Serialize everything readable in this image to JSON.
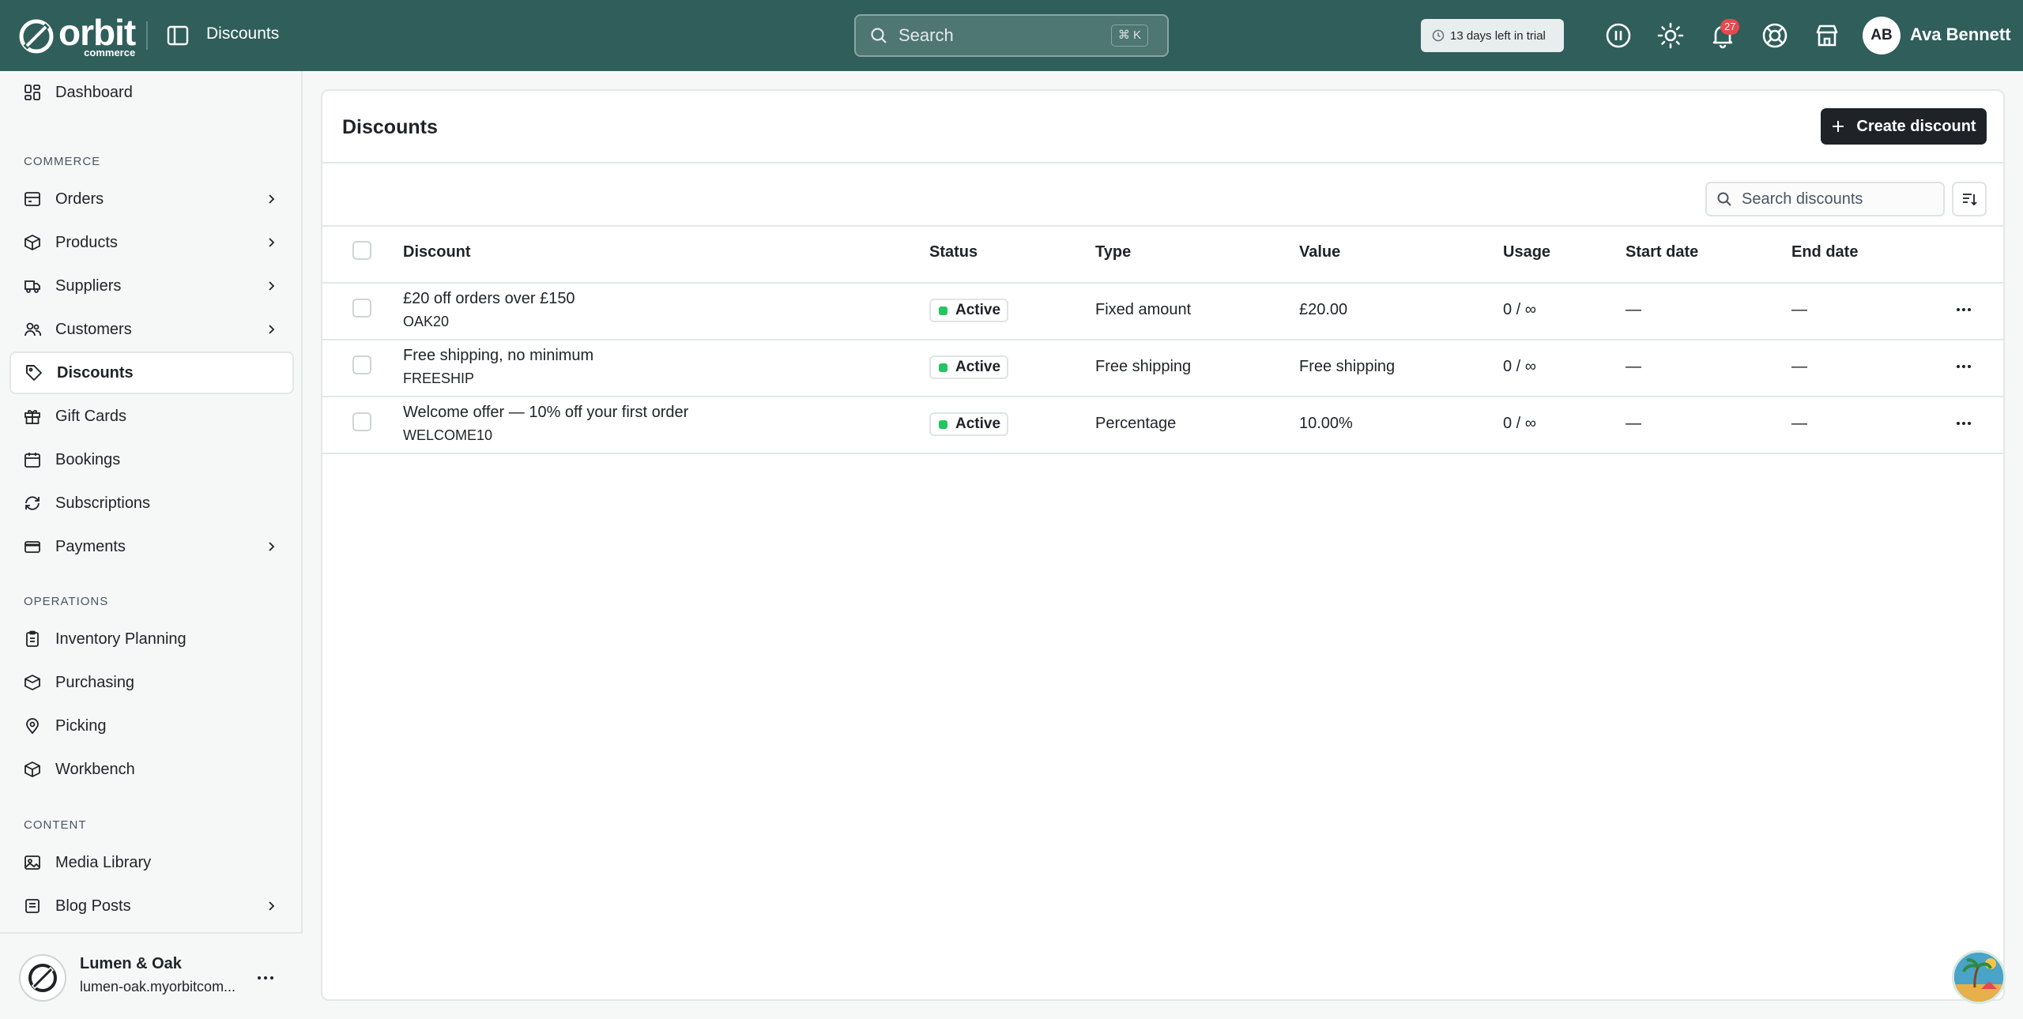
{
  "topbar": {
    "logo_text": "orbit",
    "logo_subtext": "commerce",
    "page_title": "Discounts",
    "search_placeholder": "Search",
    "search_shortcut": "⌘ K",
    "trial_text": "13 days left in trial",
    "notification_count": "27",
    "user_initials": "AB",
    "user_name": "Ava Bennett"
  },
  "sidebar": {
    "items": [
      {
        "label": "Dashboard"
      },
      {
        "label": "Orders"
      },
      {
        "label": "Products"
      },
      {
        "label": "Suppliers"
      },
      {
        "label": "Customers"
      },
      {
        "label": "Discounts"
      },
      {
        "label": "Gift Cards"
      },
      {
        "label": "Bookings"
      },
      {
        "label": "Subscriptions"
      },
      {
        "label": "Payments"
      },
      {
        "label": "Inventory Planning"
      },
      {
        "label": "Purchasing"
      },
      {
        "label": "Picking"
      },
      {
        "label": "Workbench"
      },
      {
        "label": "Media Library"
      },
      {
        "label": "Blog Posts"
      }
    ],
    "sections": {
      "commerce": "COMMERCE",
      "operations": "OPERATIONS",
      "content": "CONTENT"
    },
    "store": {
      "name": "Lumen & Oak",
      "url": "lumen-oak.myorbitcom..."
    }
  },
  "main": {
    "title": "Discounts",
    "create_label": "Create discount",
    "search_placeholder": "Search discounts",
    "columns": [
      "Discount",
      "Status",
      "Type",
      "Value",
      "Usage",
      "Start date",
      "End date"
    ],
    "rows": [
      {
        "name": "£20 off orders over £150",
        "code": "OAK20",
        "status": "Active",
        "type": "Fixed amount",
        "value": "£20.00",
        "usage": "0 / ∞",
        "start": "—",
        "end": "—"
      },
      {
        "name": "Free shipping, no minimum",
        "code": "FREESHIP",
        "status": "Active",
        "type": "Free shipping",
        "value": "Free shipping",
        "usage": "0 / ∞",
        "start": "—",
        "end": "—"
      },
      {
        "name": "Welcome offer — 10% off your first order",
        "code": "WELCOME10",
        "status": "Active",
        "type": "Percentage",
        "value": "10.00%",
        "usage": "0 / ∞",
        "start": "—",
        "end": "—"
      }
    ]
  },
  "colors": {
    "topbar": "#2f5e5b",
    "primary_button": "#1f2328",
    "status_active": "#22c55e",
    "badge": "#e5484d"
  }
}
